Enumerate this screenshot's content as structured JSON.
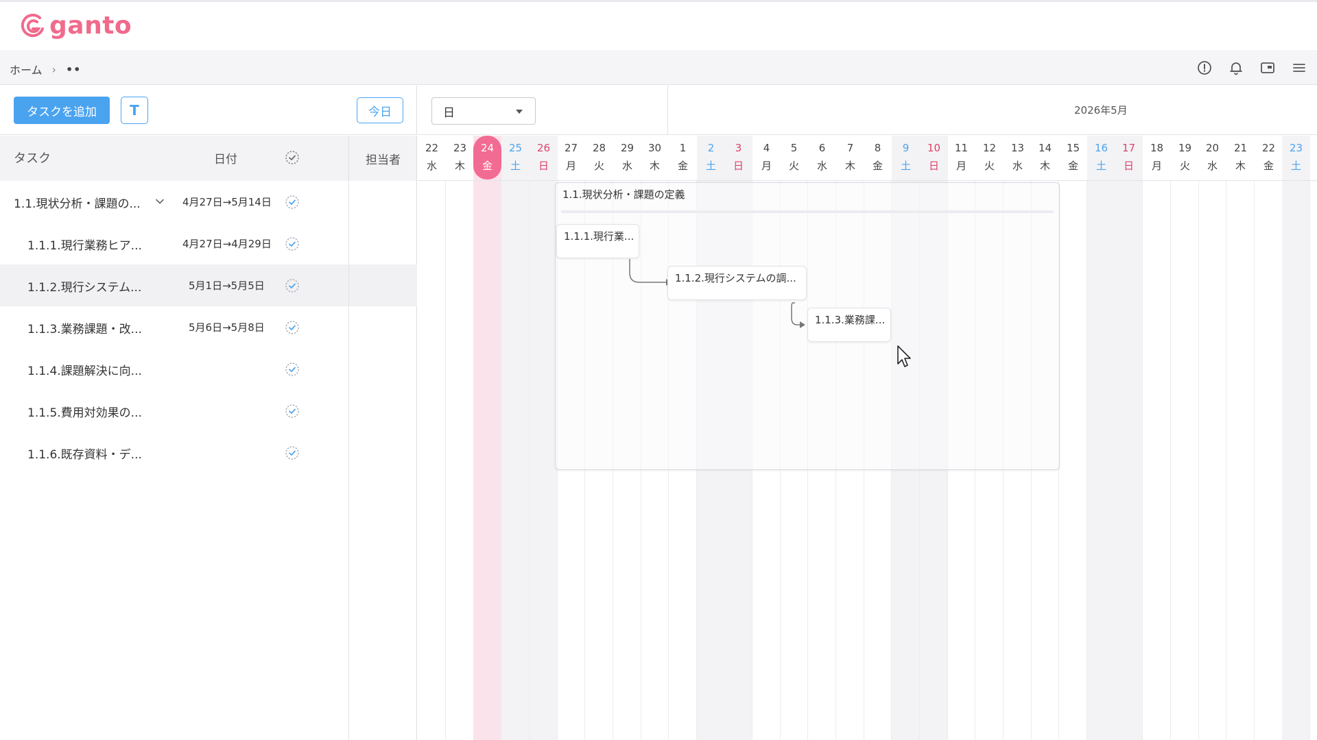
{
  "app": {
    "logo_text": "ganto",
    "brand_color": "#f06a8c",
    "accent_color": "#4aa3ef"
  },
  "breadcrumb": {
    "home": "ホーム",
    "separator": "›",
    "current": "••"
  },
  "top_icons": [
    "alert-circle-icon",
    "bell-icon",
    "window-icon",
    "hamburger-menu-icon"
  ],
  "toolbar": {
    "add_task": "タスクを追加",
    "t_button": "T",
    "today": "今日",
    "view_select": "日"
  },
  "gantt": {
    "month_label": "2026年5月",
    "days": [
      {
        "d": "22",
        "w": "水",
        "t": ""
      },
      {
        "d": "23",
        "w": "木",
        "t": ""
      },
      {
        "d": "24",
        "w": "金",
        "t": "today"
      },
      {
        "d": "25",
        "w": "土",
        "t": "sat"
      },
      {
        "d": "26",
        "w": "日",
        "t": "sun"
      },
      {
        "d": "27",
        "w": "月",
        "t": ""
      },
      {
        "d": "28",
        "w": "火",
        "t": ""
      },
      {
        "d": "29",
        "w": "水",
        "t": ""
      },
      {
        "d": "30",
        "w": "木",
        "t": ""
      },
      {
        "d": "1",
        "w": "金",
        "t": ""
      },
      {
        "d": "2",
        "w": "土",
        "t": "sat"
      },
      {
        "d": "3",
        "w": "日",
        "t": "sun"
      },
      {
        "d": "4",
        "w": "月",
        "t": ""
      },
      {
        "d": "5",
        "w": "火",
        "t": ""
      },
      {
        "d": "6",
        "w": "水",
        "t": ""
      },
      {
        "d": "7",
        "w": "木",
        "t": ""
      },
      {
        "d": "8",
        "w": "金",
        "t": ""
      },
      {
        "d": "9",
        "w": "土",
        "t": "sat"
      },
      {
        "d": "10",
        "w": "日",
        "t": "sun"
      },
      {
        "d": "11",
        "w": "月",
        "t": ""
      },
      {
        "d": "12",
        "w": "火",
        "t": ""
      },
      {
        "d": "13",
        "w": "水",
        "t": ""
      },
      {
        "d": "14",
        "w": "木",
        "t": ""
      },
      {
        "d": "15",
        "w": "金",
        "t": ""
      },
      {
        "d": "16",
        "w": "土",
        "t": "sat"
      },
      {
        "d": "17",
        "w": "日",
        "t": "sun"
      },
      {
        "d": "18",
        "w": "月",
        "t": ""
      },
      {
        "d": "19",
        "w": "火",
        "t": ""
      },
      {
        "d": "20",
        "w": "水",
        "t": ""
      },
      {
        "d": "21",
        "w": "木",
        "t": ""
      },
      {
        "d": "22",
        "w": "金",
        "t": ""
      },
      {
        "d": "23",
        "w": "土",
        "t": "sat"
      }
    ],
    "group_label": "1.1.現状分析・課題の定義",
    "bars": [
      "1.1.1.現行業...",
      "1.1.2.現行システムの調...",
      "1.1.3.業務課..."
    ]
  },
  "task_list": {
    "headers": {
      "task": "タスク",
      "date": "日付",
      "assignee": "担当者"
    },
    "rows": [
      {
        "name": "1.1.現状分析・課題の...",
        "date": "4月27日→5月14日",
        "level": 0,
        "expandable": true,
        "selected": false
      },
      {
        "name": "1.1.1.現行業務ヒア...",
        "date": "4月27日→4月29日",
        "level": 1,
        "expandable": false,
        "selected": false
      },
      {
        "name": "1.1.2.現行システム...",
        "date": "5月1日→5月5日",
        "level": 1,
        "expandable": false,
        "selected": true
      },
      {
        "name": "1.1.3.業務課題・改...",
        "date": "5月6日→5月8日",
        "level": 1,
        "expandable": false,
        "selected": false
      },
      {
        "name": "1.1.4.課題解決に向...",
        "date": "",
        "level": 1,
        "expandable": false,
        "selected": false
      },
      {
        "name": "1.1.5.費用対効果の...",
        "date": "",
        "level": 1,
        "expandable": false,
        "selected": false
      },
      {
        "name": "1.1.6.既存資料・デ...",
        "date": "",
        "level": 1,
        "expandable": false,
        "selected": false
      }
    ]
  }
}
